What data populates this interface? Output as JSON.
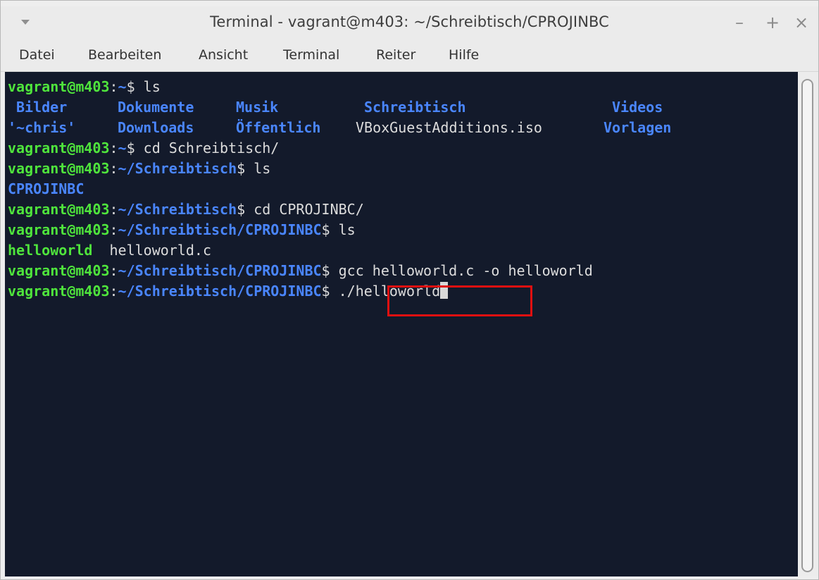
{
  "window": {
    "title": "Terminal - vagrant@m403: ~/Schreibtisch/CPROJINBC",
    "controls": {
      "minimize": "–",
      "maximize": "+",
      "close": "×"
    }
  },
  "menubar": {
    "items": [
      "Datei",
      "Bearbeiten",
      "Ansicht",
      "Terminal",
      "Reiter",
      "Hilfe"
    ]
  },
  "colors": {
    "prompt_user": "#4fe43c",
    "prompt_path": "#4a86ff",
    "terminal_bg": "#131a2b",
    "highlight_border": "#e01010"
  },
  "terminal": {
    "prompt_user": "vagrant@m403",
    "lines": {
      "l1": {
        "path": "~",
        "cmd": " ls"
      },
      "ls1_row1": [
        "Bilder",
        "Dokumente",
        "Musik",
        "Schreibtisch",
        "Videos"
      ],
      "ls1_row2": [
        "'~chris'",
        "Downloads",
        "Öffentlich",
        "VBoxGuestAdditions.iso",
        "Vorlagen"
      ],
      "l4": {
        "path": "~",
        "cmd": " cd Schreibtisch/"
      },
      "l5": {
        "path": "~/Schreibtisch",
        "cmd": " ls"
      },
      "ls2": "CPROJINBC",
      "l7": {
        "path": "~/Schreibtisch",
        "cmd": " cd CPROJINBC/"
      },
      "l8": {
        "path": "~/Schreibtisch/CPROJINBC",
        "cmd": " ls"
      },
      "ls3": [
        "helloworld",
        "helloworld.c"
      ],
      "l10": {
        "path": "~/Schreibtisch/CPROJINBC",
        "cmd": " gcc helloworld.c -o helloworld"
      },
      "l11": {
        "path": "~/Schreibtisch/CPROJINBC",
        "cmd": " ./helloworld"
      }
    }
  }
}
